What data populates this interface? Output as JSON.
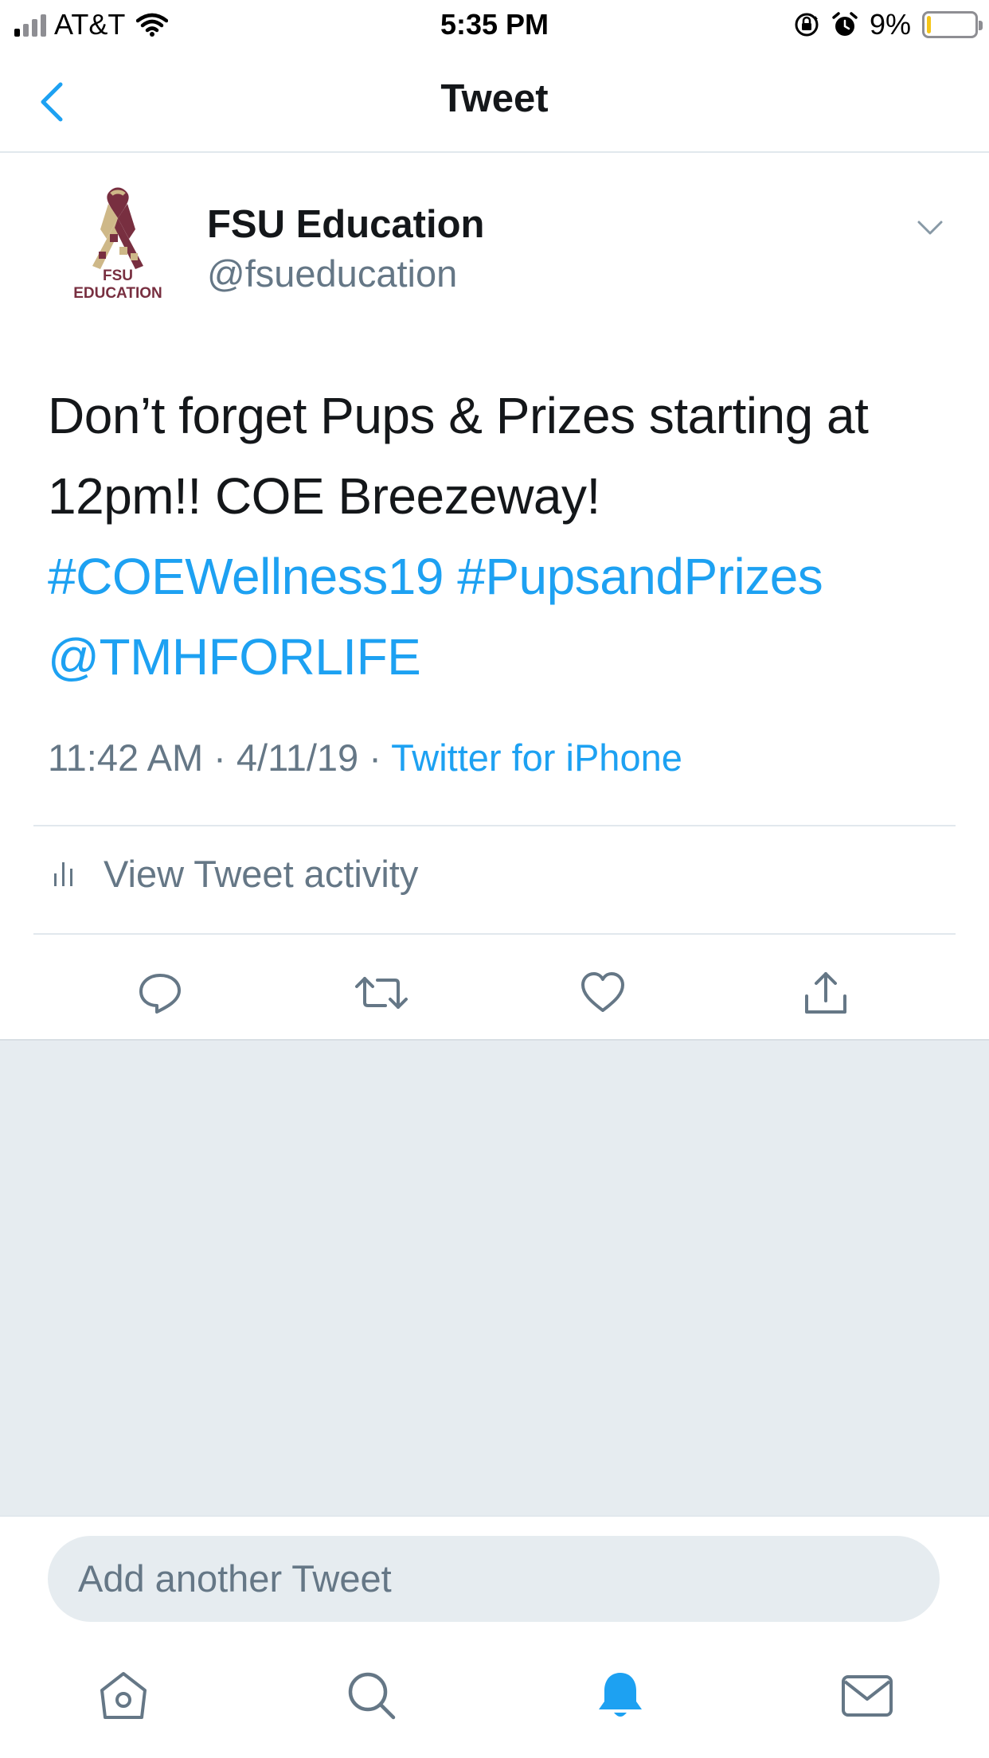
{
  "status_bar": {
    "carrier": "AT&T",
    "time": "5:35 PM",
    "battery_percent": "9%",
    "battery_level": 0.09,
    "battery_color": "#f5c518"
  },
  "nav": {
    "title": "Tweet",
    "back_icon": "chevron-left-icon"
  },
  "tweet": {
    "avatar": {
      "line1": "FSU",
      "line2": "EDUCATION"
    },
    "display_name": "FSU Education",
    "handle": "@fsueducation",
    "text": {
      "body": "Don’t forget Pups & Prizes starting at 12pm!! COE Breezeway!",
      "hashtag1": "#COEWellness19",
      "hashtag2": "#PupsandPrizes",
      "mention": "@TMHFORLIFE"
    },
    "time": "11:42 AM",
    "date": "4/11/19",
    "separator": "·",
    "source": "Twitter for iPhone",
    "activity_label": "View Tweet activity"
  },
  "actions": [
    "reply-icon",
    "retweet-icon",
    "like-icon",
    "share-icon"
  ],
  "compose": {
    "placeholder": "Add another Tweet"
  },
  "tab_bar": {
    "tabs": [
      "home-icon",
      "search-icon",
      "notifications-icon",
      "messages-icon"
    ],
    "active": "notifications-icon"
  },
  "colors": {
    "accent": "#1da1f2",
    "secondary_text": "#657786",
    "primary_text": "#14171a",
    "fsu_garnet": "#782f40",
    "fsu_gold": "#ceb888"
  }
}
